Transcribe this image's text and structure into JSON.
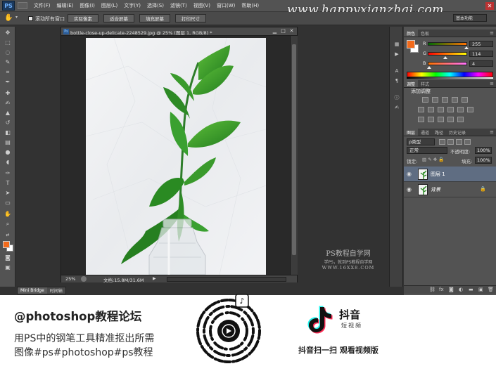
{
  "menu": {
    "logo": "PS",
    "items": [
      "文件(F)",
      "编辑(E)",
      "图像(I)",
      "图层(L)",
      "文字(Y)",
      "选择(S)",
      "滤镜(T)",
      "视图(V)",
      "窗口(W)",
      "帮助(H)"
    ]
  },
  "site_watermark": "www.happyxianzhai.com",
  "workspace_button": "基本功能",
  "options_bar": {
    "scroll_all_windows": "滚动所有窗口",
    "buttons": [
      "实际像素",
      "适合屏幕",
      "填充屏幕",
      "打印尺寸"
    ]
  },
  "document": {
    "title": "bottle-close-up-delicate-2248529.jpg @ 25% (图层 1, RGB/8) *",
    "zoom": "25%",
    "doc_size": "文档:15.8M/31.6M"
  },
  "canvas_watermark": {
    "line1": "PS教程自学网",
    "line2": "学PS，就到PS教程自学网",
    "line3": "WWW.16XX8.COM"
  },
  "mini_bridge": {
    "tabs": [
      "Mini Bridge",
      "时间轴"
    ]
  },
  "panels": {
    "color": {
      "tabs": [
        "颜色",
        "色板"
      ],
      "fg_color": "#f26a1b",
      "channels": [
        {
          "label": "R",
          "value": "255",
          "fraction": 1.0
        },
        {
          "label": "G",
          "value": "114",
          "fraction": 0.447
        },
        {
          "label": "B",
          "value": "4",
          "fraction": 0.016
        }
      ]
    },
    "adjustments": {
      "tabs": [
        "调整",
        "样式"
      ],
      "title": "添加调整"
    },
    "layers": {
      "tabs": [
        "图层",
        "通道",
        "路径",
        "历史记录"
      ],
      "kind_filter": "ρ类型",
      "blend_mode": "正常",
      "opacity_label": "不透明度:",
      "opacity": "100%",
      "lock_label": "锁定:",
      "fill_label": "填充:",
      "fill": "100%",
      "items": [
        {
          "name": "图层 1",
          "selected": true
        },
        {
          "name": "背景",
          "selected": false
        }
      ]
    }
  },
  "promo": {
    "handle": "@photoshop教程论坛",
    "line1": "用PS中的钢笔工具精准抠出所需",
    "line2": "图像#ps#photoshop#ps教程",
    "app_name": "抖音",
    "app_sub": "短视频",
    "caption": "抖音扫一扫 观看视频版"
  }
}
